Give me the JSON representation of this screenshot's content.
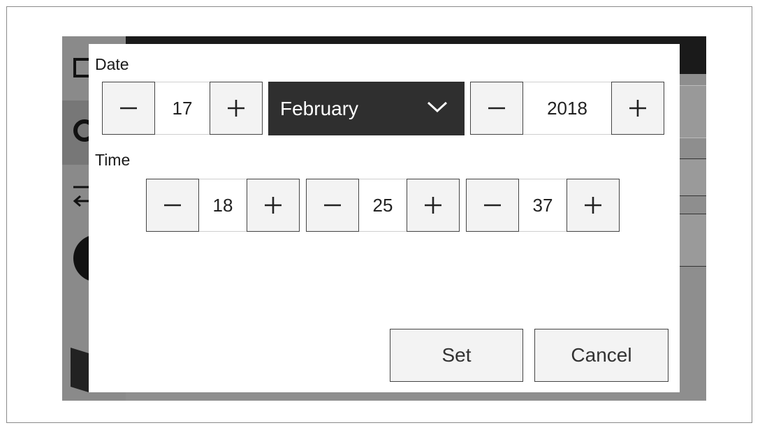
{
  "date": {
    "label": "Date",
    "day": "17",
    "month": "February",
    "year": "2018"
  },
  "time": {
    "label": "Time",
    "hour": "18",
    "minute": "25",
    "second": "37"
  },
  "actions": {
    "set_label": "Set",
    "cancel_label": "Cancel"
  },
  "icons": {
    "decrement": "minus-icon",
    "increment": "plus-icon",
    "dropdown": "chevron-down-icon"
  },
  "colors": {
    "select_bg": "#2f2f2f",
    "button_bg": "#f3f3f3",
    "overlay_bg": "#8e8e8e",
    "topbar_bg": "#1a1a1a"
  }
}
